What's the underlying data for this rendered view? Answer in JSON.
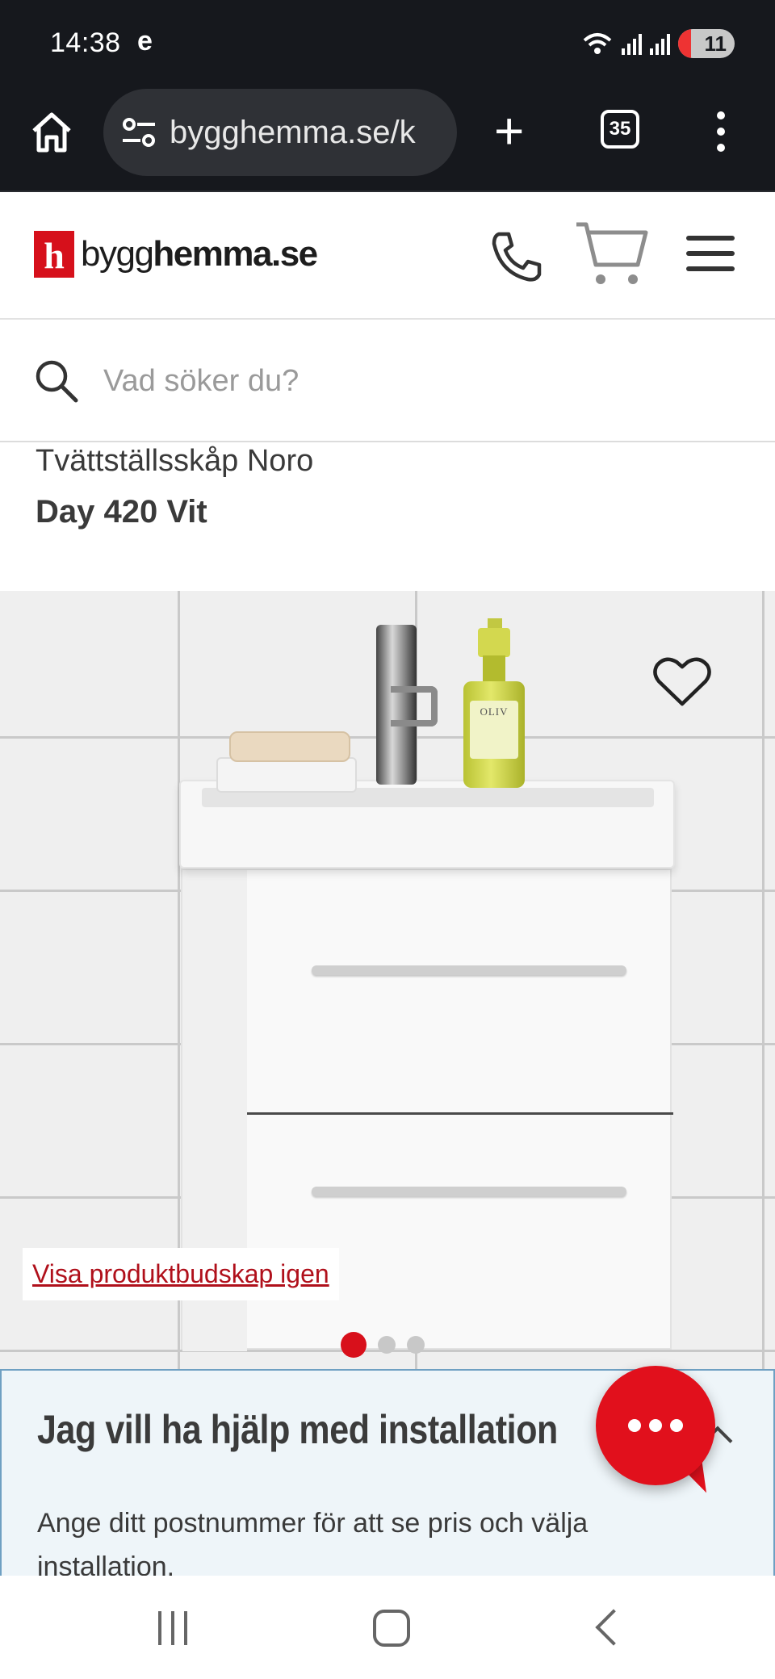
{
  "status_bar": {
    "time": "14:38",
    "carrier_glyph": "e",
    "battery_level": "11",
    "icons": [
      "wifi-icon",
      "signal-icon",
      "signal-icon",
      "battery-icon"
    ]
  },
  "browser": {
    "url": "bygghemma.se/k",
    "tab_count": "35",
    "icons": [
      "home-icon",
      "tune-icon",
      "plus-icon",
      "tabs-icon",
      "more-vert-icon"
    ]
  },
  "site": {
    "logo_mark": "h",
    "logo_prefix": "bygg",
    "logo_suffix": "hemma.se",
    "brand_color": "#d6101b",
    "header_icons": [
      "phone-icon",
      "cart-icon",
      "hamburger-menu-icon"
    ]
  },
  "search": {
    "placeholder": "Vad söker du?",
    "icon": "search-icon"
  },
  "product": {
    "brand_line": "Tvättställsskåp Noro",
    "name": "Day 420 Vit",
    "bottle_label": "OLIV",
    "promo_link": "Visa produktbudskap igen",
    "gallery_dots": 3,
    "gallery_active_index": 0,
    "favorite_icon": "heart-outline-icon"
  },
  "installation": {
    "title": "Jag vill ha hjälp med installation",
    "description": "Ange ditt postnummer för att se pris och välja installation.",
    "panel_color": "#eef5f9",
    "chevron_icon": "chevron-up-icon"
  },
  "chat": {
    "icon": "chat-bubble-icon",
    "color": "#e1101c"
  },
  "nav_bar": {
    "icons": [
      "recents-icon",
      "home-icon",
      "back-icon"
    ]
  }
}
